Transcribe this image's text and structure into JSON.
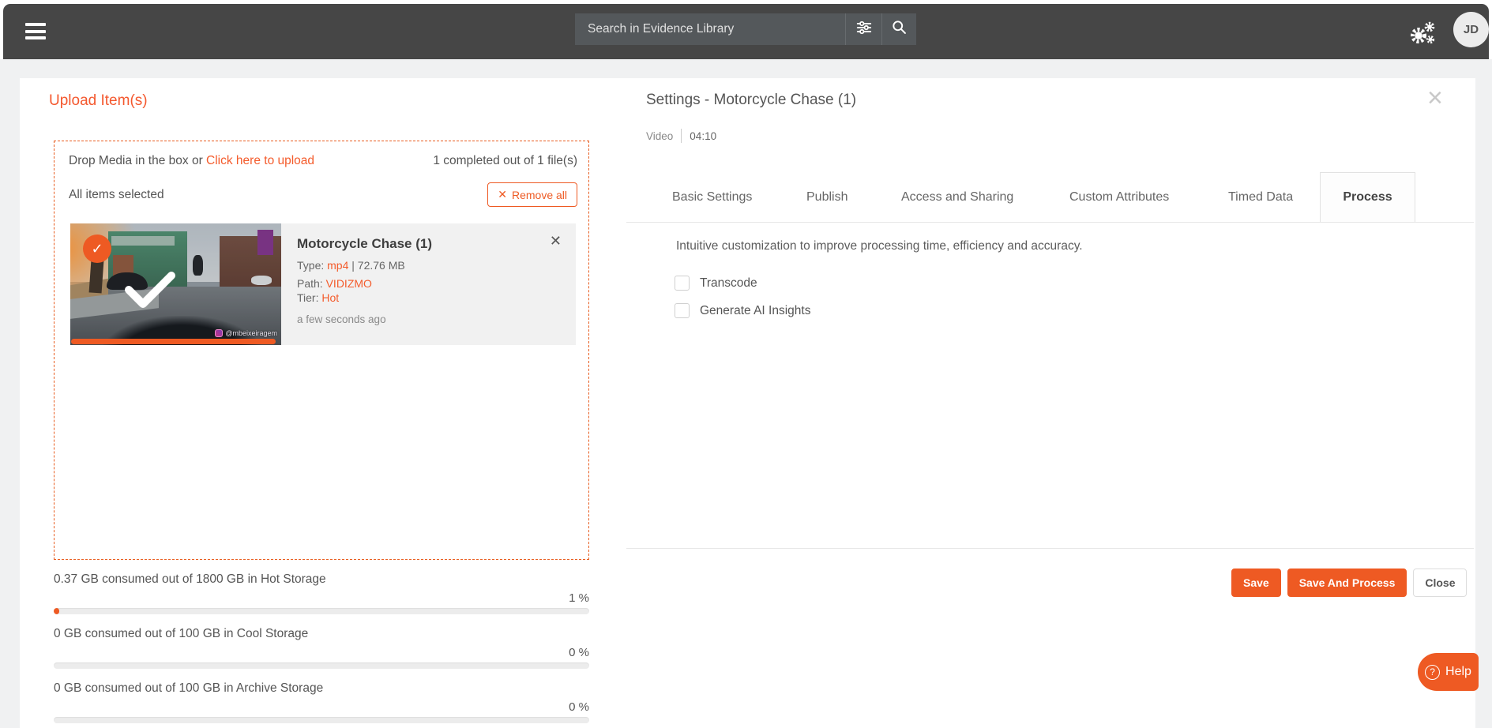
{
  "topbar": {
    "search_placeholder": "Search in Evidence Library",
    "avatar_initials": "JD"
  },
  "upload_panel": {
    "title": "Upload Item(s)",
    "dropzone_text": "Drop Media in the box or ",
    "dropzone_link": "Click here to upload",
    "completed_text": "1 completed out of 1 file(s)",
    "selection_text": "All items selected",
    "remove_all_icon": "✕",
    "remove_all_label": "Remove all",
    "file": {
      "title": "Motorcycle Chase (1)",
      "type_label": "Type: ",
      "type_value": "mp4",
      "size_sep": " | ",
      "size": "72.76 MB",
      "path_label": "Path: ",
      "path_value": "VIDIZMO",
      "tier_label": "Tier: ",
      "tier_value": "Hot",
      "timestamp": "a few seconds ago",
      "watermark": "@mbeixeiragem",
      "selected_check": "✓",
      "close_icon": "✕"
    },
    "storage": [
      {
        "label": "0.37 GB consumed out of 1800 GB in Hot Storage",
        "percent_label": "1 %",
        "percent": 1
      },
      {
        "label": "0 GB consumed out of 100 GB in Cool Storage",
        "percent_label": "0 %",
        "percent": 0
      },
      {
        "label": "0 GB consumed out of 100 GB in Archive Storage",
        "percent_label": "0 %",
        "percent": 0
      }
    ]
  },
  "settings_panel": {
    "title": "Settings - Motorcycle Chase (1)",
    "close_icon": "×",
    "media_type": "Video",
    "duration": "04:10",
    "tabs": [
      {
        "label": "Basic Settings",
        "active": false
      },
      {
        "label": "Publish",
        "active": false
      },
      {
        "label": "Access and Sharing",
        "active": false
      },
      {
        "label": "Custom Attributes",
        "active": false
      },
      {
        "label": "Timed Data",
        "active": false
      },
      {
        "label": "Process",
        "active": true
      }
    ],
    "description": "Intuitive customization to improve processing time, efficiency and accuracy.",
    "options": [
      {
        "label": "Transcode",
        "checked": false
      },
      {
        "label": "Generate AI Insights",
        "checked": false
      }
    ],
    "buttons": {
      "save": "Save",
      "save_and_process": "Save And Process",
      "close": "Close"
    }
  },
  "help": {
    "icon": "?",
    "label": "Help"
  },
  "colors": {
    "accent_orange": "#ee5a23",
    "link_orange": "#f45b2b",
    "topbar_gray": "#464646",
    "page_background": "#f0f1f2",
    "card_details_background": "#f1f1f1"
  }
}
